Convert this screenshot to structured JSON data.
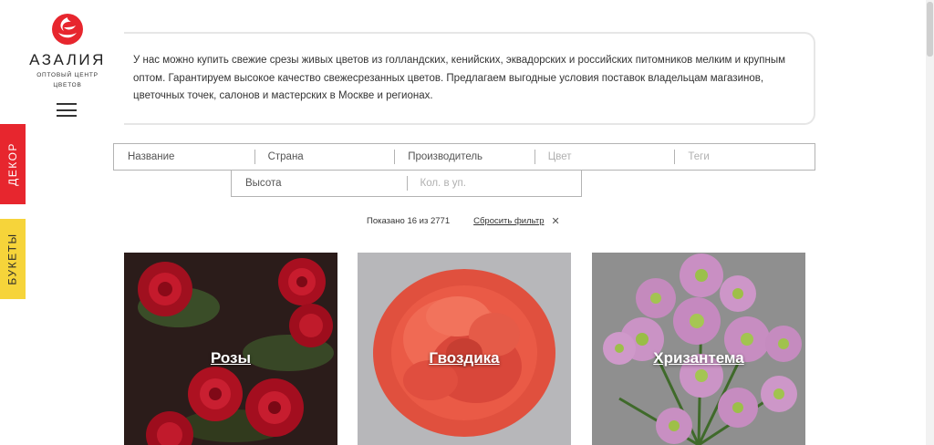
{
  "logo": {
    "title": "АЗАЛИЯ",
    "subtitle_line1": "ОПТОВЫЙ ЦЕНТР",
    "subtitle_line2": "ЦВЕТОВ",
    "icon": "rose-logo-icon",
    "brand_color": "#e7262e"
  },
  "menu": {
    "icon": "hamburger-icon"
  },
  "side_tabs": {
    "decor": {
      "label": "ДЕКОР",
      "color": "#e7262e"
    },
    "bouquets": {
      "label": "БУКЕТЫ",
      "color": "#f6d43a"
    }
  },
  "intro": {
    "text": "У нас можно купить свежие срезы живых цветов из голландских, кенийских, эквадорских и российских питомников мелким и крупным оптом. Гарантируем высокое качество свежесрезанных цветов. Предлагаем выгодные условия поставок владельцам магазинов, цветочных точек, салонов и мастерских в Москве и регионах."
  },
  "filters": {
    "name": {
      "placeholder": "Название",
      "value": ""
    },
    "country": {
      "placeholder": "Страна",
      "value": ""
    },
    "producer": {
      "placeholder": "Производитель",
      "value": ""
    },
    "color": {
      "placeholder": "Цвет",
      "value": ""
    },
    "tags": {
      "placeholder": "Теги",
      "value": ""
    },
    "height": {
      "placeholder": "Высота",
      "value": ""
    },
    "pack_qty": {
      "placeholder": "Кол. в уп.",
      "value": ""
    }
  },
  "results": {
    "shown_text": "Показано 16 из 2771",
    "reset_label": "Сбросить фильтр",
    "reset_icon": "close-icon"
  },
  "categories": [
    {
      "label": "Розы"
    },
    {
      "label": "Гвоздика"
    },
    {
      "label": "Хризантема"
    }
  ]
}
